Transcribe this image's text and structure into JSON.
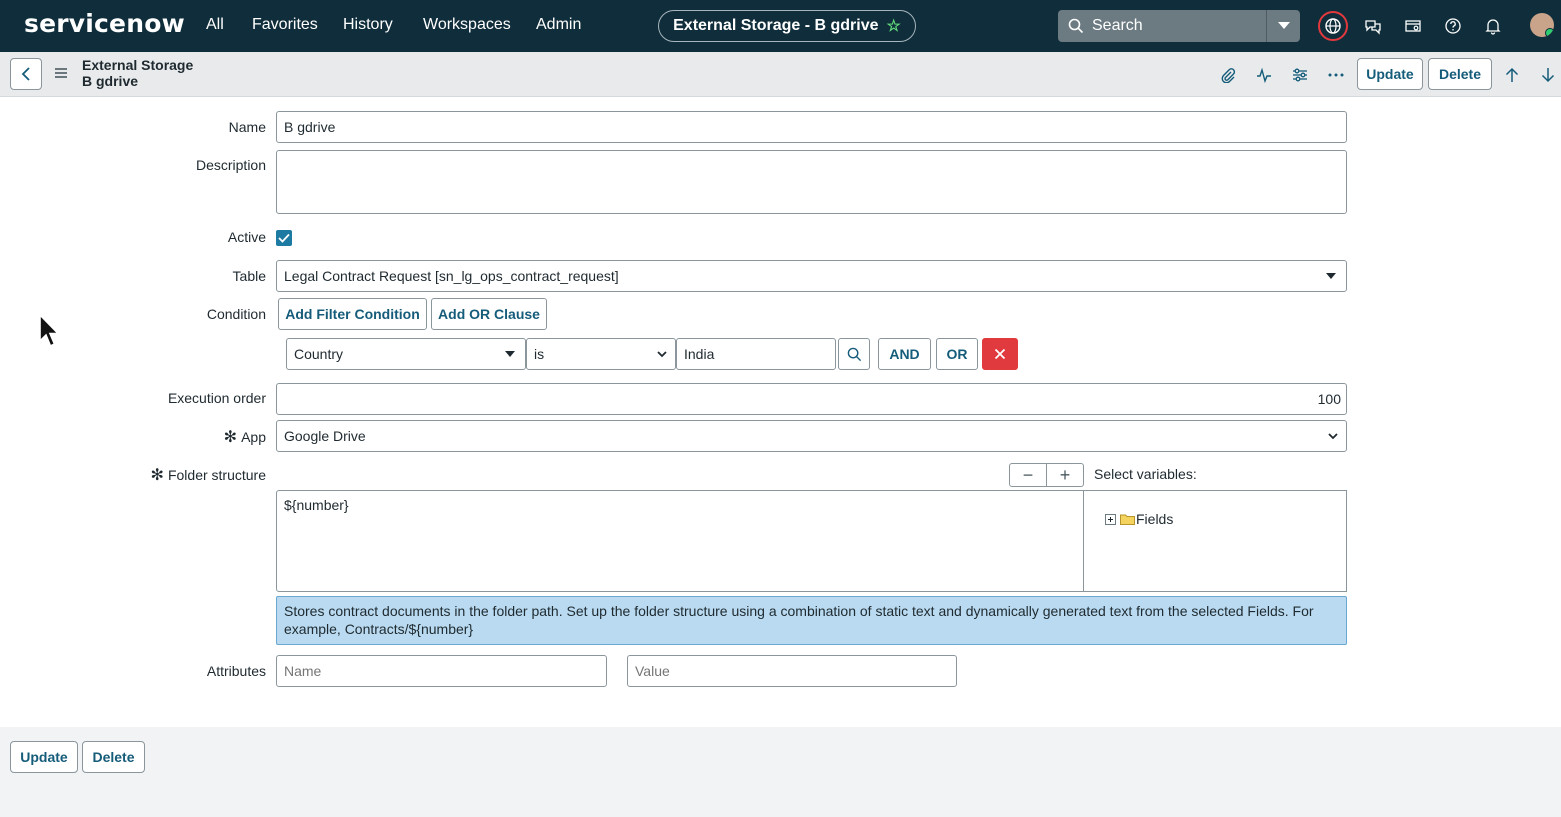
{
  "nav": {
    "logo": "servicenow",
    "links": [
      "All",
      "Favorites",
      "History",
      "Workspaces",
      "Admin"
    ],
    "record_title": "External Storage - B gdrive",
    "search_placeholder": "Search"
  },
  "header": {
    "title_line1": "External Storage",
    "title_line2": "B gdrive",
    "update_label": "Update",
    "delete_label": "Delete"
  },
  "form": {
    "name_label": "Name",
    "name_value": "B gdrive",
    "description_label": "Description",
    "description_value": "",
    "active_label": "Active",
    "active_checked": true,
    "table_label": "Table",
    "table_value": "Legal Contract Request [sn_lg_ops_contract_request]",
    "condition_label": "Condition",
    "add_filter_label": "Add Filter Condition",
    "add_or_label": "Add OR Clause",
    "condition_field": "Country",
    "condition_operator": "is",
    "condition_value": "India",
    "and_label": "AND",
    "or_label": "OR",
    "execution_order_label": "Execution order",
    "execution_order_value": "100",
    "app_label": "App",
    "app_value": "Google Drive",
    "folder_label": "Folder structure",
    "folder_value": "${number}",
    "select_variables_label": "Select variables:",
    "tree_root": "Fields",
    "info_text": "Stores contract documents in the folder path. Set up the folder structure using a combination of static text and dynamically generated text from the selected Fields. For example, Contracts/${number}",
    "attributes_label": "Attributes",
    "attr_name_placeholder": "Name",
    "attr_value_placeholder": "Value",
    "required_mark": "✻"
  },
  "footer": {
    "update_label": "Update",
    "delete_label": "Delete"
  },
  "colors": {
    "nav_bg": "#0f2d3a",
    "accent": "#155c7a",
    "info_bg": "#b9daf0",
    "delete_red": "#e0393e",
    "checkbox": "#1d7aa3"
  }
}
